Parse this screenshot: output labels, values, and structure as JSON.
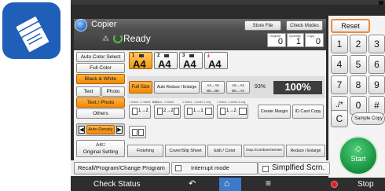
{
  "left_app": {
    "icon": "document-stack-icon"
  },
  "window": {
    "title": "Copier",
    "status": "Ready"
  },
  "header_buttons": {
    "store_file": "Store File",
    "check_modes": "Check Modes",
    "reset": "Reset"
  },
  "counters": [
    {
      "label": "Original",
      "value": "0"
    },
    {
      "label": "Quantity",
      "value": "1"
    },
    {
      "label": "Copy",
      "value": "0"
    }
  ],
  "color_modes": [
    "Auto Color Select",
    "Full Color",
    "Black & White"
  ],
  "selected_color_mode": "Black & White",
  "original_types": [
    "Text",
    "Photo",
    "Text / Photo",
    "Others"
  ],
  "selected_original_type": "Text / Photo",
  "density": {
    "label": "Auto Density"
  },
  "original_setting": {
    "line1": "A4□",
    "line2": "Original Setting"
  },
  "trays": [
    {
      "number": "1",
      "size": "A4",
      "selected": true
    },
    {
      "number": "2",
      "size": "A4",
      "selected": false
    },
    {
      "number": "3",
      "size": "A4",
      "selected": false
    },
    {
      "number": "",
      "size": "A4",
      "selected": false
    }
  ],
  "reduce_row": {
    "full_size": "Full Size",
    "auto_reduce_enlarge": "Auto Reduce / Enlarge",
    "preset1": "A4→A5 B5→B6",
    "preset2": "A5→A4 B5→A4",
    "ratio": "93%",
    "current": "100%"
  },
  "duplex_captions": [
    "1 Sided→2 Sided: TtoT",
    "1 Sided→2 Sided",
    "1 Sided→Combi: 2 orig.",
    "1 Sided→Combi: 4 orig."
  ],
  "duplex_icon_labels": [
    "1→2",
    "2→2",
    "1→1",
    "1→2"
  ],
  "create_margin": "Create Margin",
  "id_card_copy": "ID Card Copy",
  "bottom_tabs": [
    "Finishing",
    "Cover/Slip Sheet",
    "Edit / Color",
    "Dup./Combine/Series",
    "Reduce / Enlarge"
  ],
  "keypad": [
    "1",
    "2",
    "3",
    "4",
    "5",
    "6",
    "7",
    "8",
    "9",
    "./*",
    "0",
    "#"
  ],
  "clear_key": "C",
  "sample_copy": "Sample Copy",
  "start": {
    "label": "Start",
    "icon": "diamond-icon",
    "color": "#1a9a45"
  },
  "footer_row": {
    "recall": "Recall/Program/Change Program",
    "interrupt": "Interrupt mode",
    "simplified": "Simplfied Scrn."
  },
  "navbar": {
    "check_status": "Check Status",
    "stop": "Stop"
  },
  "colors": {
    "accent": "#f08a00",
    "start_green": "#1a9a45",
    "stop_red": "#e02020",
    "home_blue": "#3d7ac8"
  }
}
